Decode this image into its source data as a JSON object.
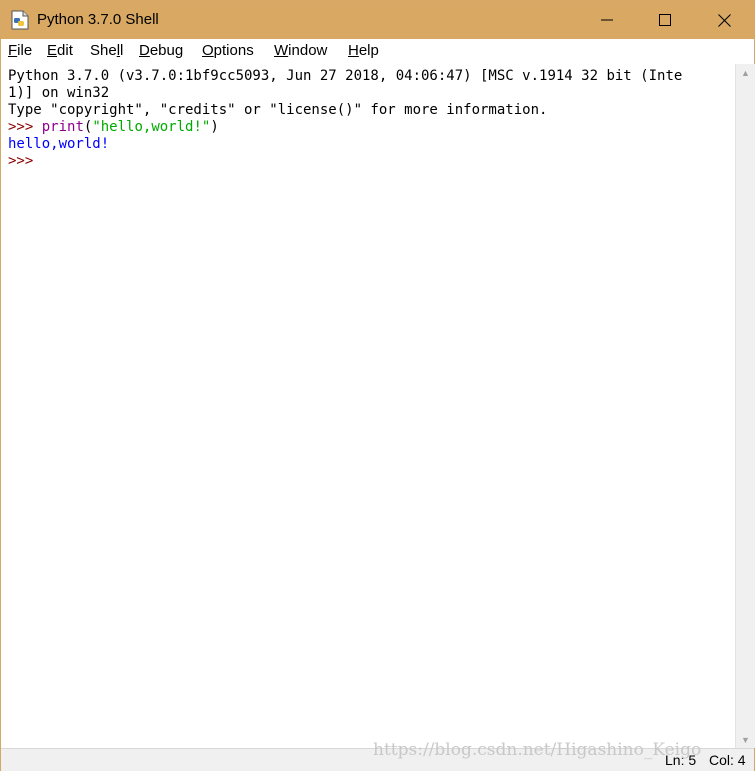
{
  "window": {
    "title": "Python 3.7.0 Shell",
    "icon": "python-file-icon",
    "controls": {
      "minimize": "minimize-icon",
      "maximize": "maximize-icon",
      "close": "close-icon"
    }
  },
  "menu": [
    {
      "label_pre": "",
      "mnemonic": "F",
      "label_post": "ile"
    },
    {
      "label_pre": "",
      "mnemonic": "E",
      "label_post": "dit"
    },
    {
      "label_pre": "She",
      "mnemonic": "l",
      "label_post": "l"
    },
    {
      "label_pre": "",
      "mnemonic": "D",
      "label_post": "ebug"
    },
    {
      "label_pre": "",
      "mnemonic": "O",
      "label_post": "ptions"
    },
    {
      "label_pre": "",
      "mnemonic": "W",
      "label_post": "indow"
    },
    {
      "label_pre": "",
      "mnemonic": "H",
      "label_post": "elp"
    }
  ],
  "shell": {
    "banner_line1": "Python 3.7.0 (v3.7.0:1bf9cc5093, Jun 27 2018, 04:06:47) [MSC v.1914 32 bit (Inte",
    "banner_line2": "1)] on win32",
    "banner_line3": "Type \"copyright\", \"credits\" or \"license()\" for more information.",
    "prompt": ">>>",
    "input_func": "print",
    "input_open": "(",
    "input_string": "\"hello,world!\"",
    "input_close": ")",
    "output": "hello,world!",
    "prompt2": ">>>"
  },
  "status": {
    "line": "Ln: 5",
    "col": "Col: 4"
  },
  "watermark": "https://blog.csdn.net/Higashino_Keigo",
  "colors": {
    "titlebar": "#d9a964",
    "prompt": "#8b0000",
    "builtin": "#900090",
    "string": "#00aa00",
    "output": "#0000ff"
  }
}
